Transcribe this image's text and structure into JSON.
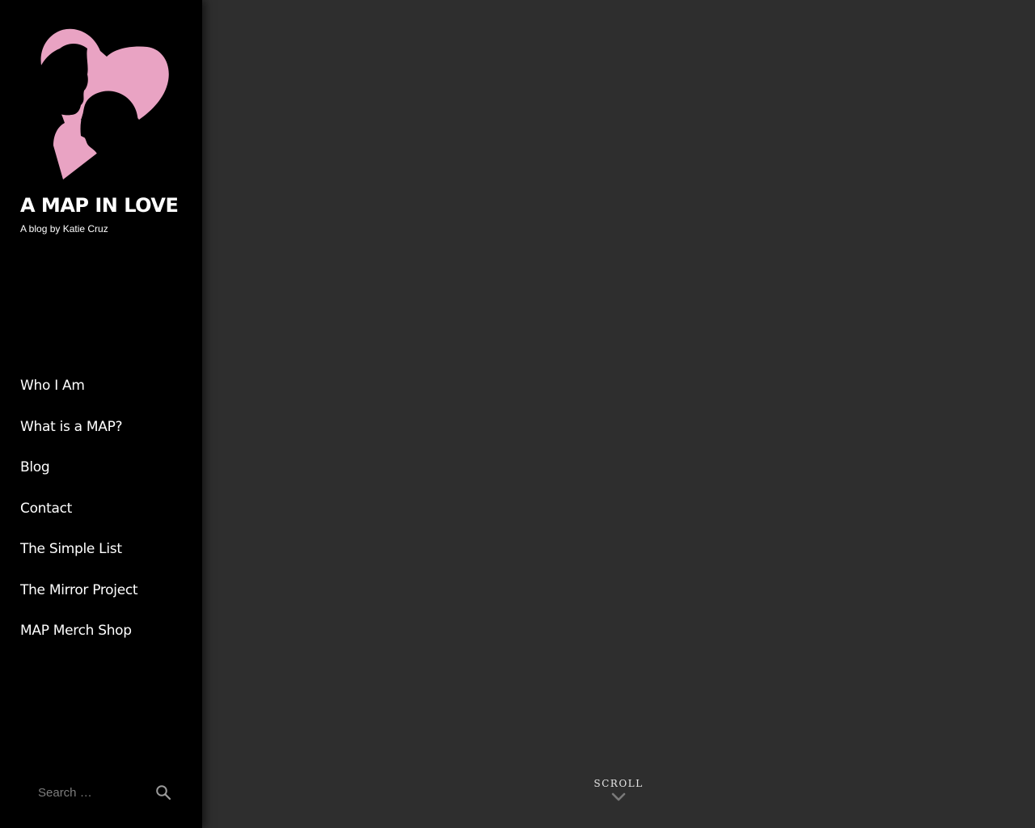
{
  "site": {
    "title": "A MAP IN LOVE",
    "description": "A blog by Katie Cruz",
    "logo_icon": "heart-silhouette-couple-icon",
    "logo_color": "#e9a3c3"
  },
  "nav": {
    "items": [
      {
        "label": "Who I Am"
      },
      {
        "label": "What is a MAP?"
      },
      {
        "label": "Blog"
      },
      {
        "label": "Contact"
      },
      {
        "label": "The Simple List"
      },
      {
        "label": "The Mirror Project"
      },
      {
        "label": "MAP Merch Shop"
      }
    ]
  },
  "search": {
    "placeholder": "Search …",
    "value": "",
    "icon": "search-icon"
  },
  "scroll": {
    "label": "SCROLL",
    "icon": "chevron-down-icon"
  },
  "colors": {
    "sidebar_background": "#000000",
    "content_background": "#2e2e2e",
    "text": "#ffffff"
  }
}
